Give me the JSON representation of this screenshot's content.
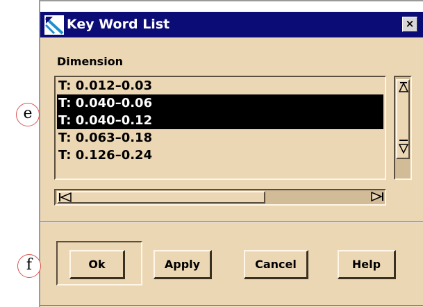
{
  "window": {
    "title": "Key Word List",
    "close_label": "×"
  },
  "list": {
    "label": "Dimension",
    "items": [
      {
        "text": "T: 0.012–0.03",
        "selected": false
      },
      {
        "text": "T: 0.040–0.06",
        "selected": true
      },
      {
        "text": "T: 0.040–0.12",
        "selected": true
      },
      {
        "text": "T: 0.063–0.18",
        "selected": false
      },
      {
        "text": "T: 0.126–0.24",
        "selected": false
      }
    ]
  },
  "buttons": {
    "ok": "Ok",
    "apply": "Apply",
    "cancel": "Cancel",
    "help": "Help"
  },
  "callouts": {
    "e": "e",
    "f": "f"
  },
  "colors": {
    "titlebar": "#0c0c76",
    "dialog_bg": "#ecd7b5",
    "selection": "#000000"
  }
}
